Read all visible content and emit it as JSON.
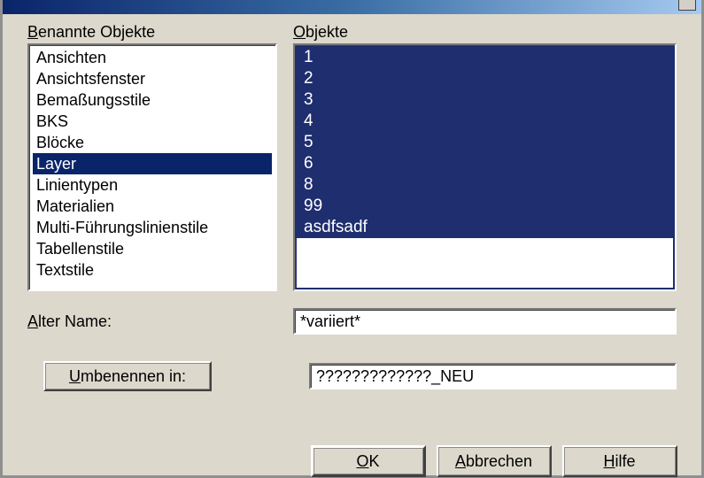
{
  "labels": {
    "named_objects_prefix": "B",
    "named_objects_rest": "enannte Objekte",
    "objects_prefix": "O",
    "objects_rest": "bjekte",
    "old_name_prefix": "A",
    "old_name_rest": "lter Name:",
    "rename_prefix": "U",
    "rename_rest": "mbenennen in:",
    "ok_prefix": "O",
    "ok_rest": "K",
    "cancel_prefix": "A",
    "cancel_rest": "bbrechen",
    "help_prefix": "H",
    "help_rest": "ilfe"
  },
  "named_objects": {
    "items": [
      "Ansichten",
      "Ansichtsfenster",
      "Bemaßungsstile",
      "BKS",
      "Blöcke",
      "Layer",
      "Linientypen",
      "Materialien",
      "Multi-Führungslinienstile",
      "Tabellenstile",
      "Textstile"
    ],
    "selected_index": 5
  },
  "objects": {
    "items": [
      "1",
      "2",
      "3",
      "4",
      "5",
      "6",
      "8",
      "99",
      "asdfsadf"
    ]
  },
  "fields": {
    "old_name_value": "*variiert*",
    "rename_to_value": "?????????????_NEU"
  }
}
